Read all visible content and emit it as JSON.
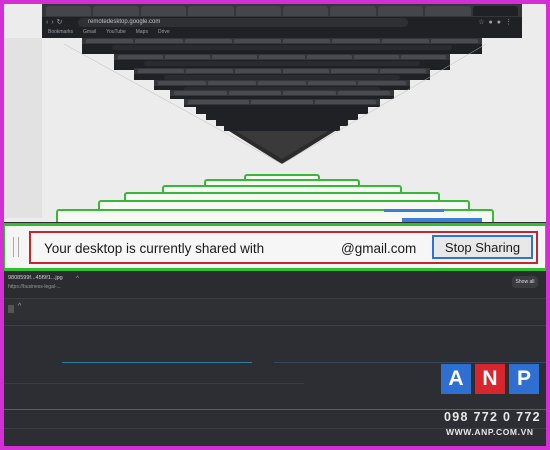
{
  "share_bar": {
    "message": "Your desktop is currently shared with",
    "email": "@gmail.com",
    "stop_button": "Stop Sharing"
  },
  "browser": {
    "url": "remotedesktop.google.com",
    "bookmarks": [
      "Bookmarks",
      "Gmail",
      "YouTube",
      "Maps",
      "Drive"
    ]
  },
  "downloads": {
    "file_name": "9808599f...45f9f1...jpg",
    "file_url": "https://business-legal-...",
    "show_all": "Show all"
  },
  "watermark": {
    "letters": [
      "A",
      "N",
      "P"
    ],
    "letter_colors": [
      "#2f6fd1",
      "#d8262e",
      "#2f6fd1"
    ],
    "phone": "098 772 0 772",
    "website": "WWW.ANP.COM.VN"
  },
  "colors": {
    "outer_border": "#d42fd4",
    "share_bar_outline": "#2fbf2f",
    "message_outline": "#c4262c",
    "stop_button_outline": "#2e74d6"
  }
}
